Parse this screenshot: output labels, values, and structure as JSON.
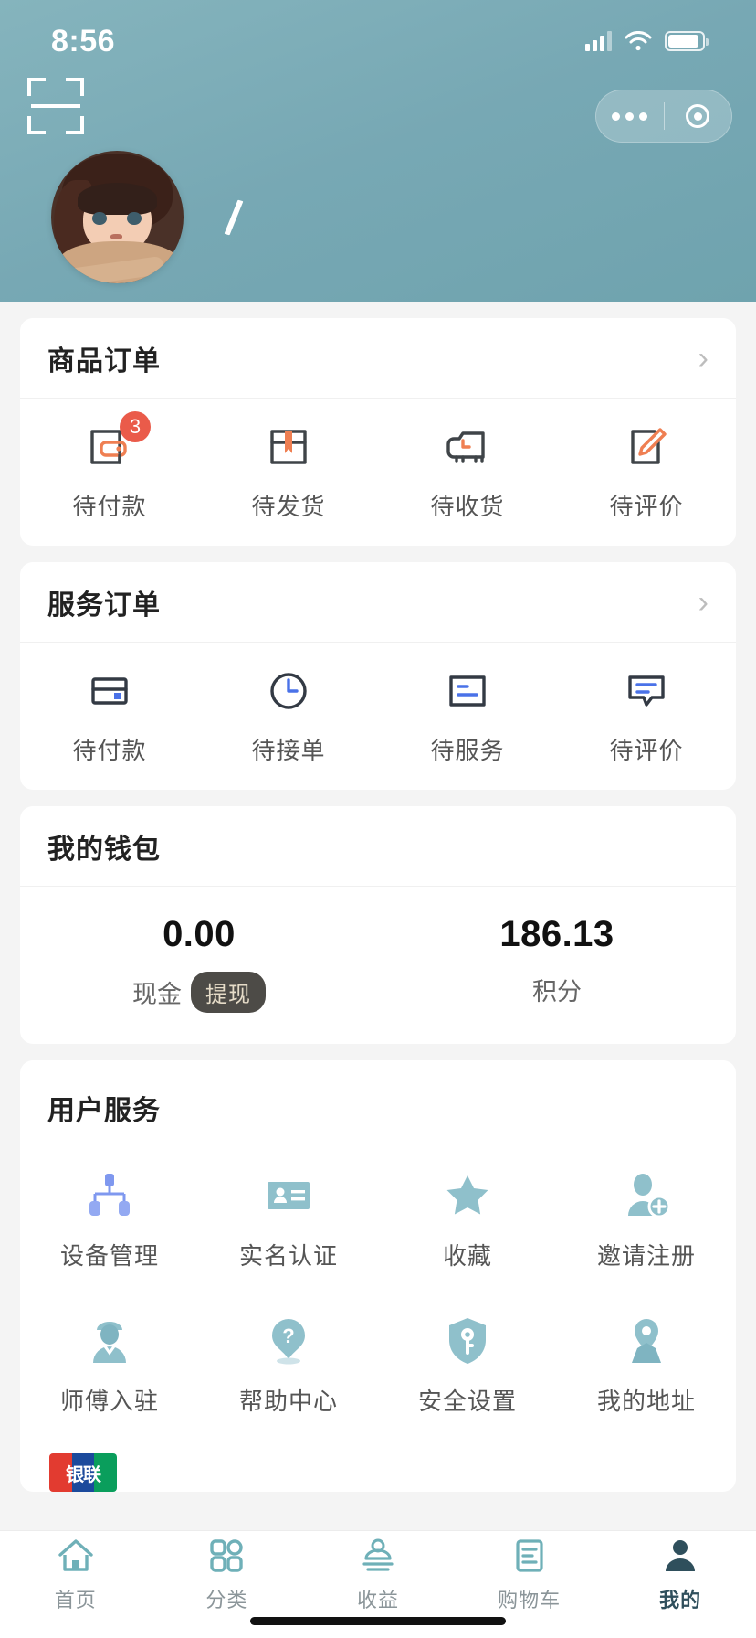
{
  "status_bar": {
    "time": "8:56",
    "signal_icon": "cellular-signal-icon",
    "wifi_icon": "wifi-icon",
    "battery_icon": "battery-icon"
  },
  "header": {
    "scan_icon": "scan-qr-icon",
    "capsule": {
      "more_icon": "more-dots-icon",
      "target_icon": "target-circle-icon"
    },
    "avatar": "user-avatar",
    "nickname": "\\"
  },
  "product_orders": {
    "title": "商品订单",
    "chevron": "chevron-right-icon",
    "items": [
      {
        "label": "待付款",
        "icon": "wallet-pay-icon",
        "badge": "3"
      },
      {
        "label": "待发货",
        "icon": "package-box-icon",
        "badge": ""
      },
      {
        "label": "待收货",
        "icon": "delivery-truck-icon",
        "badge": ""
      },
      {
        "label": "待评价",
        "icon": "review-pencil-icon",
        "badge": ""
      }
    ]
  },
  "service_orders": {
    "title": "服务订单",
    "chevron": "chevron-right-icon",
    "items": [
      {
        "label": "待付款",
        "icon": "card-pay-icon"
      },
      {
        "label": "待接单",
        "icon": "clock-icon"
      },
      {
        "label": "待服务",
        "icon": "document-lines-icon"
      },
      {
        "label": "待评价",
        "icon": "comment-bubble-icon"
      }
    ]
  },
  "wallet": {
    "title": "我的钱包",
    "cash": {
      "amount": "0.00",
      "label": "现金",
      "action": "提现"
    },
    "points": {
      "amount": "186.13",
      "label": "积分"
    }
  },
  "user_services": {
    "title": "用户服务",
    "items": [
      {
        "label": "设备管理",
        "icon": "device-tree-icon"
      },
      {
        "label": "实名认证",
        "icon": "id-card-icon"
      },
      {
        "label": "收藏",
        "icon": "star-icon"
      },
      {
        "label": "邀请注册",
        "icon": "user-add-icon"
      },
      {
        "label": "师傅入驻",
        "icon": "worker-icon"
      },
      {
        "label": "帮助中心",
        "icon": "help-question-icon"
      },
      {
        "label": "安全设置",
        "icon": "shield-key-icon"
      },
      {
        "label": "我的地址",
        "icon": "location-pin-icon"
      }
    ],
    "unionpay_logo": "银联"
  },
  "tabbar": {
    "items": [
      {
        "label": "首页",
        "icon": "home-icon",
        "active": false
      },
      {
        "label": "分类",
        "icon": "grid-category-icon",
        "active": false
      },
      {
        "label": "收益",
        "icon": "earnings-icon",
        "active": false
      },
      {
        "label": "购物车",
        "icon": "cart-icon",
        "active": false
      },
      {
        "label": "我的",
        "icon": "profile-person-icon",
        "active": true
      }
    ]
  },
  "colors": {
    "header_bg": "#77a8b4",
    "accent_orange": "#ef7f52",
    "badge_red": "#ea5b4a",
    "accent_blue": "#4a72e8",
    "teal": "#8fc0cb",
    "tab_active": "#2f4f5c"
  }
}
